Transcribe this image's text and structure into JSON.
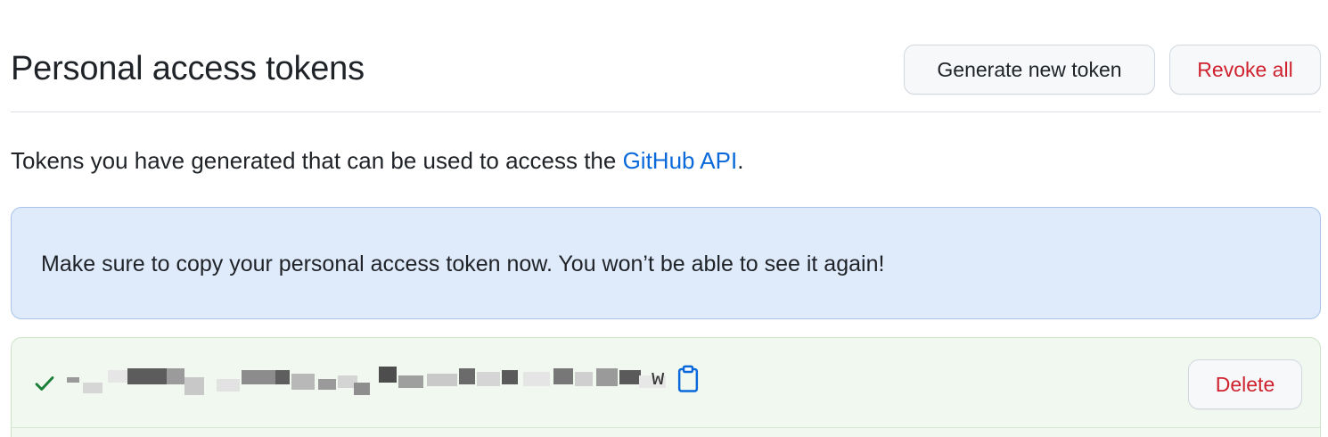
{
  "header": {
    "title": "Personal access tokens",
    "generate_label": "Generate new token",
    "revoke_label": "Revoke all"
  },
  "intro": {
    "text_before": "Tokens you have generated that can be used to access the ",
    "link_text": "GitHub API",
    "text_after": "."
  },
  "flash": {
    "message": "Make sure to copy your personal access token now. You won’t be able to see it again!"
  },
  "token": {
    "status_icon": "check-icon",
    "value_visible_suffix": "w",
    "copy_icon": "clipboard-icon",
    "delete_label": "Delete"
  },
  "colors": {
    "danger": "#cf222e",
    "link": "#0969da",
    "success": "#1a7f37",
    "info_bg": "#dfebfb",
    "success_bg": "#f1f8ef"
  }
}
